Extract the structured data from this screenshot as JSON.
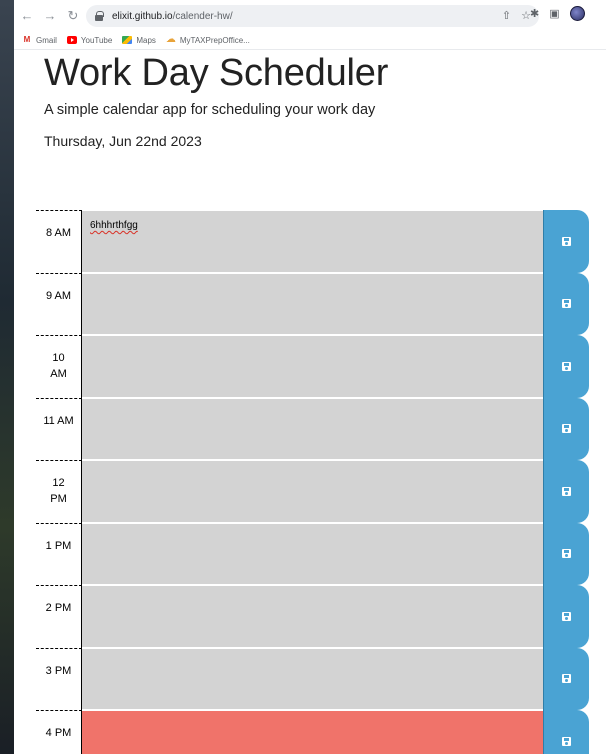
{
  "browser": {
    "url_host": "elixit.github.io",
    "url_path": "/calender-hw/",
    "bookmarks": [
      "Gmail",
      "YouTube",
      "Maps",
      "MyTAXPrepOffice..."
    ]
  },
  "header": {
    "title": "Work Day Scheduler",
    "lead": "A simple calendar app for scheduling your work day",
    "current_day": "Thursday, Jun 22nd 2023"
  },
  "timeblocks": [
    {
      "hour": "8 AM",
      "text": "6hhhrthfgg",
      "state": "past"
    },
    {
      "hour": "9 AM",
      "text": "",
      "state": "past"
    },
    {
      "hour": "10 AM",
      "text": "",
      "state": "past"
    },
    {
      "hour": "11 AM",
      "text": "",
      "state": "past"
    },
    {
      "hour": "12 PM",
      "text": "",
      "state": "past"
    },
    {
      "hour": "1 PM",
      "text": "",
      "state": "past"
    },
    {
      "hour": "2 PM",
      "text": "",
      "state": "past"
    },
    {
      "hour": "3 PM",
      "text": "",
      "state": "past"
    },
    {
      "hour": "4 PM",
      "text": "",
      "state": "present"
    }
  ],
  "colors": {
    "past": "#d3d3d3",
    "present": "#f0736a",
    "save_button": "#4aa3d3"
  },
  "icons": {
    "save": "floppy-disk-icon"
  }
}
